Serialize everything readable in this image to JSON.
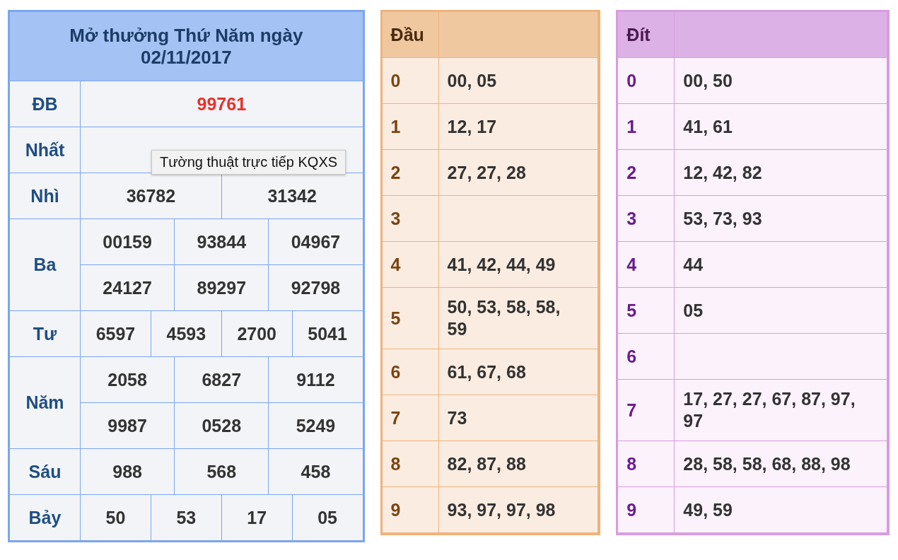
{
  "results": {
    "title_line_1": "Mở thưởng Thứ Năm ngày",
    "title_line_2": "02/11/2017",
    "prizes": [
      {
        "label": "ĐB",
        "kind": "special",
        "rows": [
          [
            "99761"
          ]
        ]
      },
      {
        "label": "Nhất"
      },
      {
        "label": "Nhì",
        "kind": "regular",
        "rows": [
          [
            "36782",
            "31342"
          ]
        ]
      },
      {
        "label": "Ba",
        "kind": "regular",
        "rows": [
          [
            "00159",
            "93844",
            "04967"
          ],
          [
            "24127",
            "89297",
            "92798"
          ]
        ]
      },
      {
        "label": "Tư",
        "kind": "regular",
        "rows": [
          [
            "6597",
            "4593",
            "2700",
            "5041"
          ]
        ]
      },
      {
        "label": "Năm",
        "kind": "regular",
        "rows": [
          [
            "2058",
            "6827",
            "9112"
          ],
          [
            "9987",
            "0528",
            "5249"
          ]
        ]
      },
      {
        "label": "Sáu",
        "kind": "regular",
        "rows": [
          [
            "988",
            "568",
            "458"
          ]
        ]
      },
      {
        "label": "Bảy",
        "kind": "regular",
        "rows": [
          [
            "50",
            "53",
            "17",
            "05"
          ]
        ]
      }
    ],
    "tooltip": "Tường thuật trực tiếp KQXS"
  },
  "dau_table": {
    "heading": "Đầu",
    "rows": [
      {
        "digit": "0",
        "numbers": "00, 05"
      },
      {
        "digit": "1",
        "numbers": "12, 17"
      },
      {
        "digit": "2",
        "numbers": "27, 27, 28"
      },
      {
        "digit": "3",
        "numbers": ""
      },
      {
        "digit": "4",
        "numbers": "41, 42, 44, 49"
      },
      {
        "digit": "5",
        "numbers": "50, 53, 58, 58, 59"
      },
      {
        "digit": "6",
        "numbers": "61, 67, 68"
      },
      {
        "digit": "7",
        "numbers": "73"
      },
      {
        "digit": "8",
        "numbers": "82, 87, 88"
      },
      {
        "digit": "9",
        "numbers": "93, 97, 97, 98"
      }
    ]
  },
  "dit_table": {
    "heading": "Đít",
    "rows": [
      {
        "digit": "0",
        "numbers": "00, 50"
      },
      {
        "digit": "1",
        "numbers": "41, 61"
      },
      {
        "digit": "2",
        "numbers": "12, 42, 82"
      },
      {
        "digit": "3",
        "numbers": "53, 73, 93"
      },
      {
        "digit": "4",
        "numbers": "44"
      },
      {
        "digit": "5",
        "numbers": "05"
      },
      {
        "digit": "6",
        "numbers": ""
      },
      {
        "digit": "7",
        "numbers": "17, 27, 27, 67, 87, 97, 97"
      },
      {
        "digit": "8",
        "numbers": "28, 58, 58, 68, 88, 98"
      },
      {
        "digit": "9",
        "numbers": "49, 59"
      }
    ]
  }
}
